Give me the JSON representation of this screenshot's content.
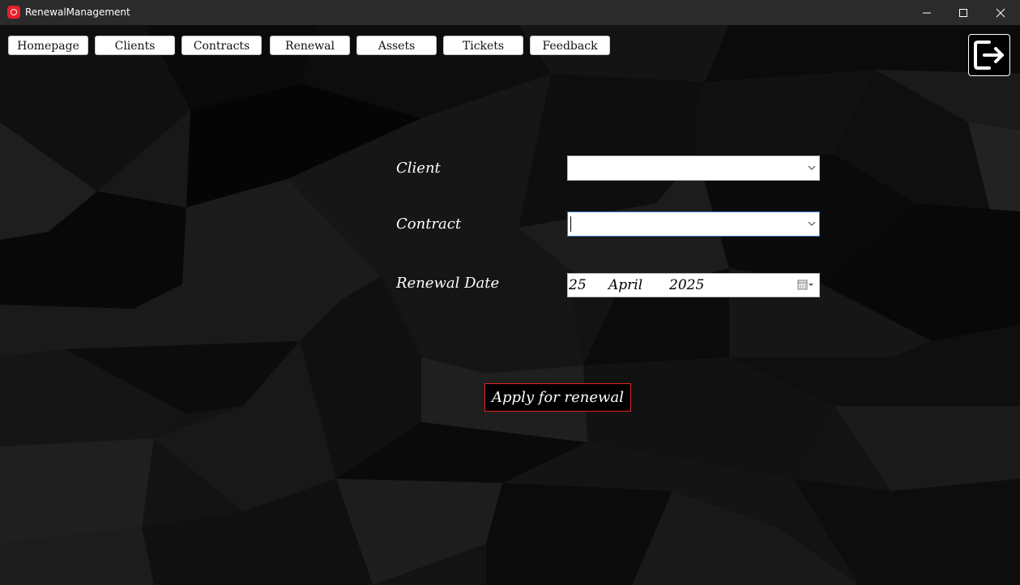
{
  "window": {
    "title": "RenewalManagement"
  },
  "nav": [
    {
      "label": "Homepage"
    },
    {
      "label": "Clients"
    },
    {
      "label": "Contracts"
    },
    {
      "label": "Renewal"
    },
    {
      "label": "Assets"
    },
    {
      "label": "Tickets"
    },
    {
      "label": "Feedback"
    }
  ],
  "form": {
    "client_label": "Client",
    "client_value": "",
    "contract_label": "Contract",
    "contract_value": "",
    "renewal_date_label": "Renewal Date",
    "renewal_date": {
      "day": "25",
      "month": "April",
      "year": "2025"
    },
    "apply_button": "Apply for renewal"
  },
  "icons": {
    "logout": "logout-icon",
    "dropdown": "chevron-down-icon",
    "calendar": "calendar-icon"
  },
  "colors": {
    "accent_border": "#e0221f",
    "focus_border": "#3a7bd5",
    "app_icon": "#e8202a"
  }
}
